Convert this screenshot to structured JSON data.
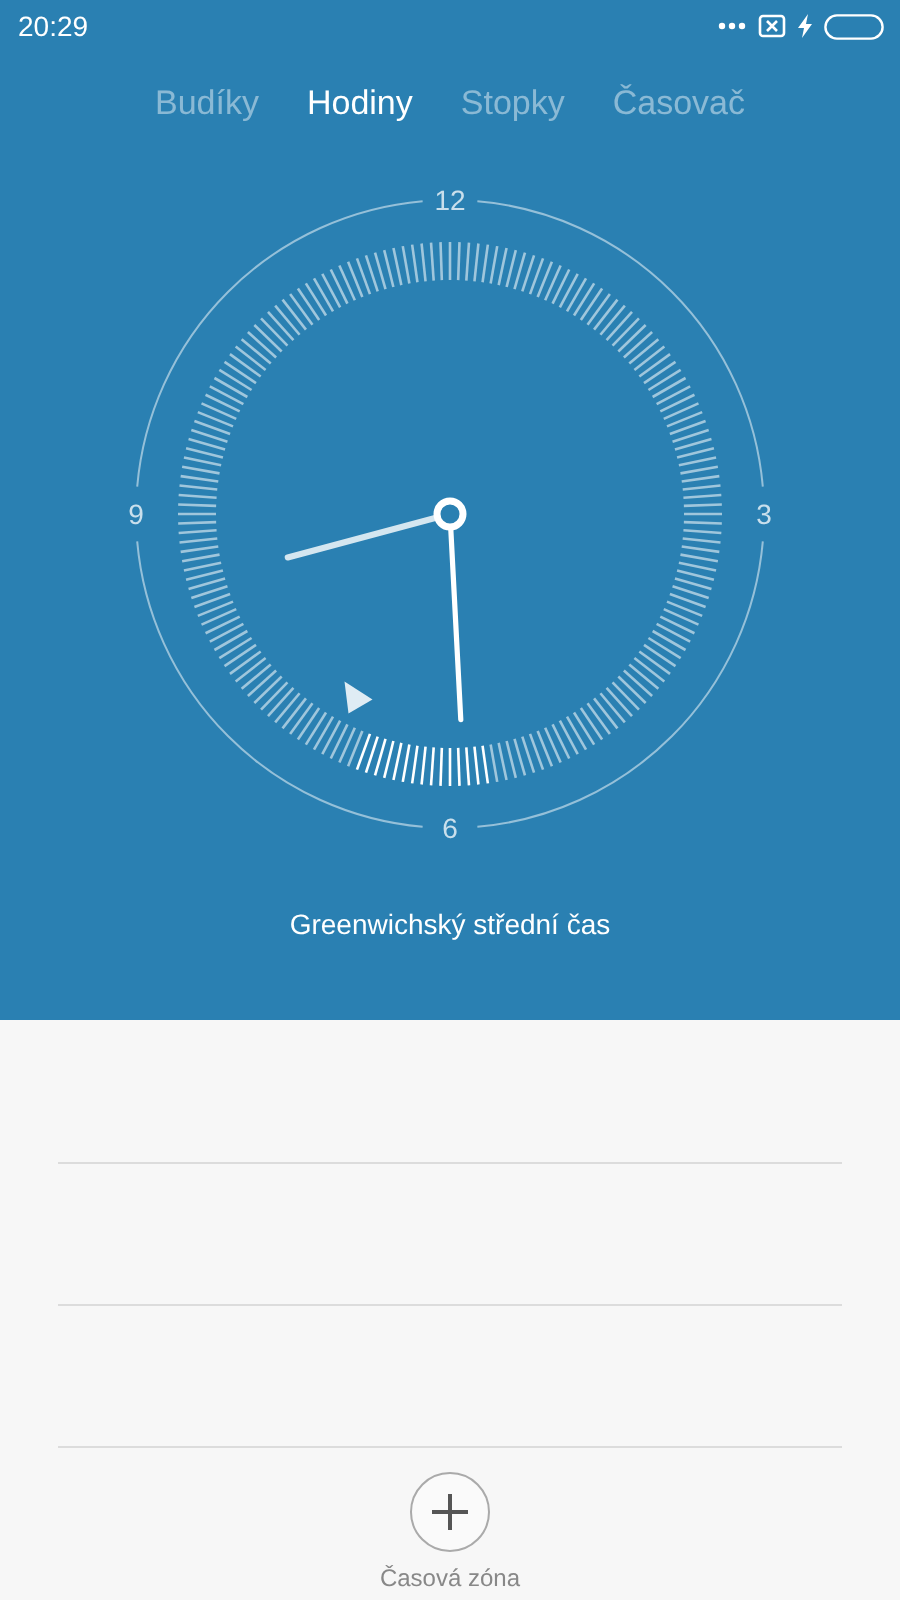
{
  "status_bar": {
    "time": "20:29"
  },
  "tabs": [
    {
      "label": "Budíky",
      "selected": false
    },
    {
      "label": "Hodiny",
      "selected": true
    },
    {
      "label": "Stopky",
      "selected": false
    },
    {
      "label": "Časovač",
      "selected": false
    }
  ],
  "clock": {
    "numerals": [
      "12",
      "3",
      "6",
      "9"
    ],
    "timezone": "Greenwichský střední čas"
  },
  "add_button": {
    "label": "Časová zóna"
  }
}
